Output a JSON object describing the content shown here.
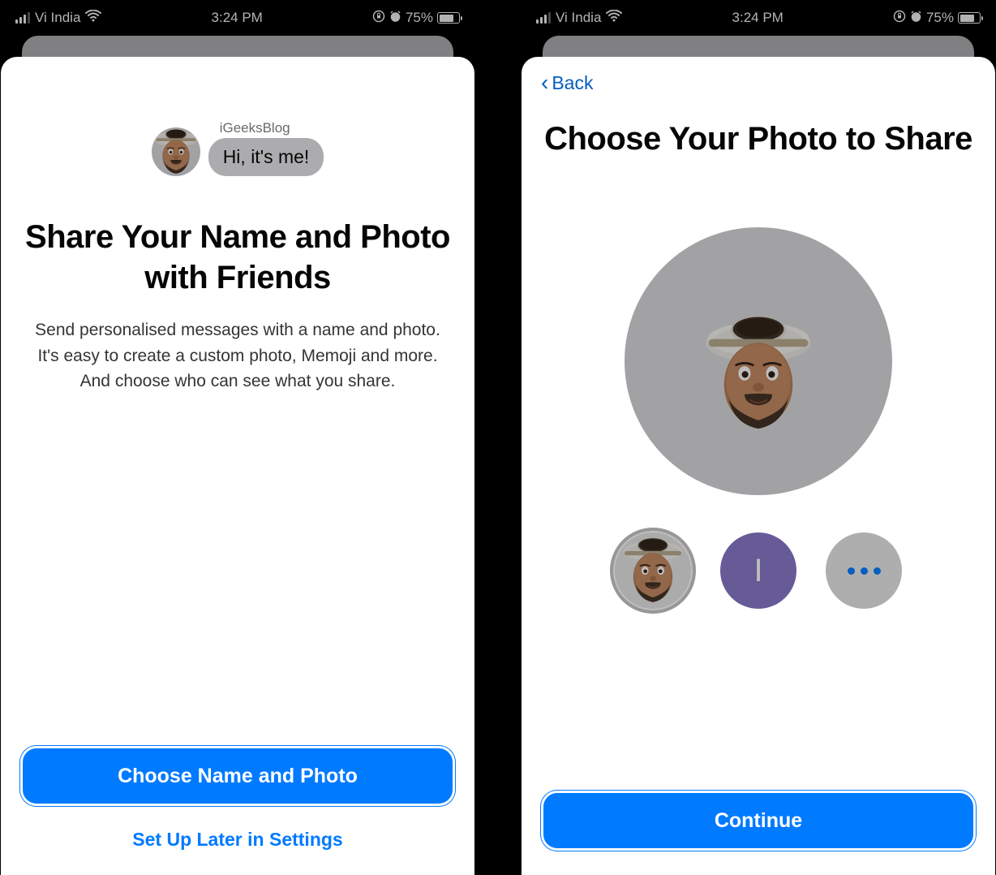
{
  "statusbar": {
    "carrier": "Vi India",
    "time": "3:24 PM",
    "battery": "75%"
  },
  "left": {
    "preview_sender": "iGeeksBlog",
    "preview_msg": "Hi, it's me!",
    "title": "Share Your Name and Photo with Friends",
    "desc": "Send personalised messages with a name and photo. It's easy to create a custom photo, Memoji and more. And choose who can see what you share.",
    "primary_btn": "Choose Name and Photo",
    "secondary_link": "Set Up Later in Settings"
  },
  "right": {
    "back_label": "Back",
    "title": "Choose Your Photo to Share",
    "options": {
      "initial": "I"
    },
    "primary_btn": "Continue"
  }
}
